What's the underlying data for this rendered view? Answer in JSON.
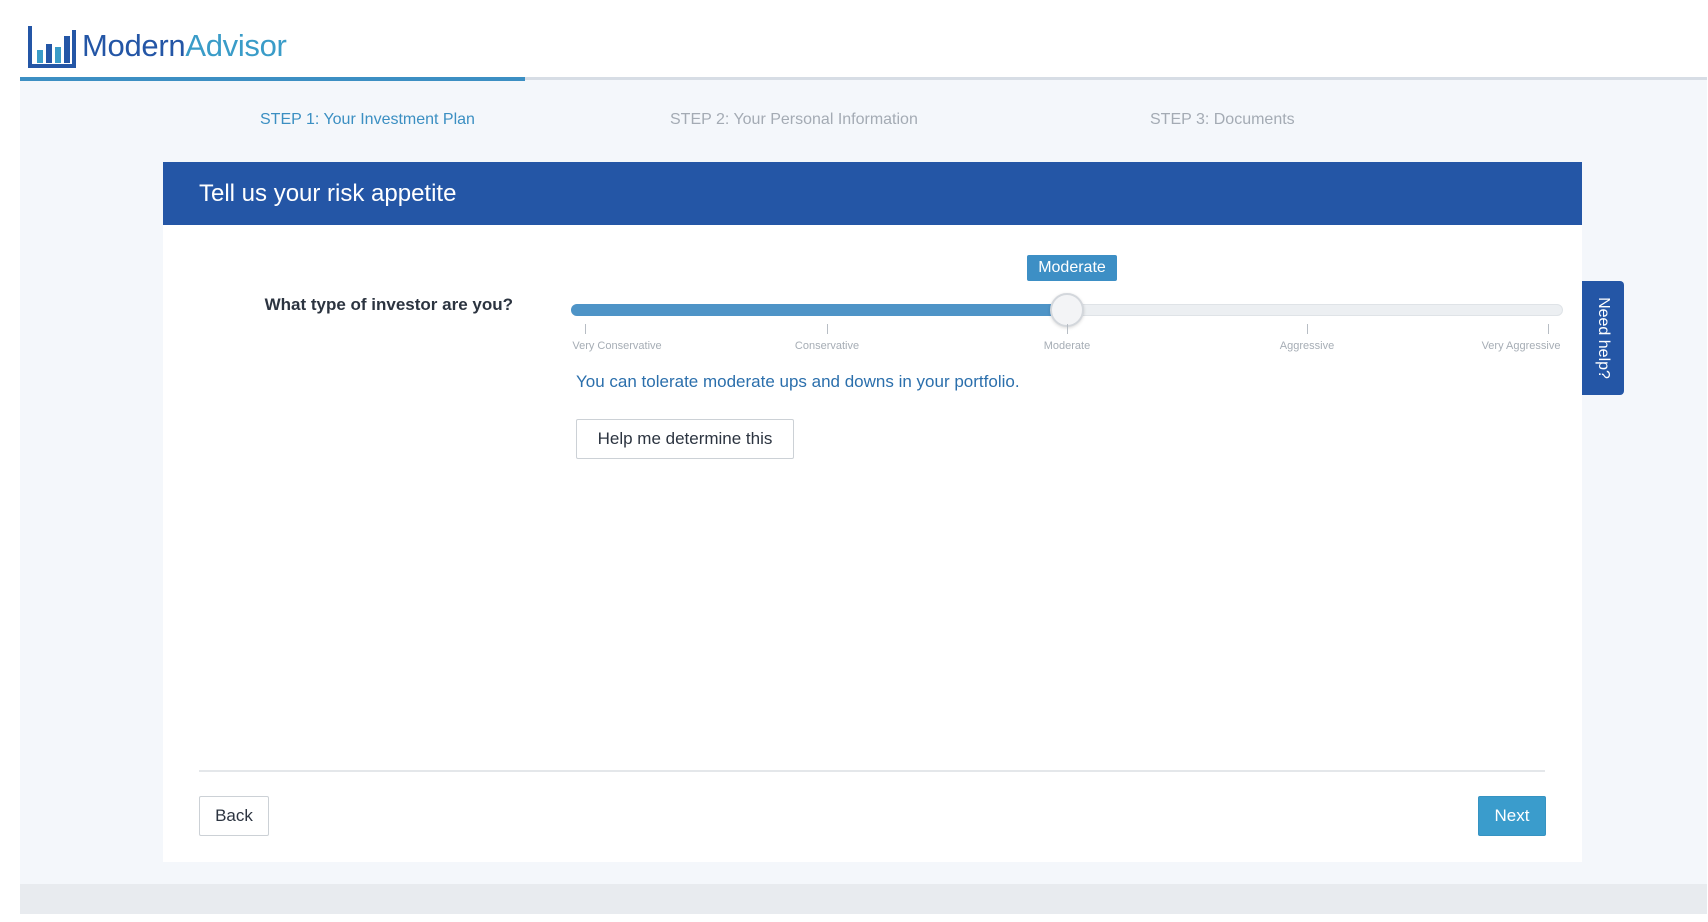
{
  "brand": {
    "part1": "Modern",
    "part2": "Advisor"
  },
  "colors": {
    "brand_blue": "#2456a6",
    "accent": "#3a9ccc",
    "link": "#2b6fac",
    "muted": "#a4abb4"
  },
  "steps": [
    {
      "label": "STEP 1: Your Investment Plan",
      "active": true
    },
    {
      "label": "STEP 2: Your Personal Information",
      "active": false
    },
    {
      "label": "STEP 3: Documents",
      "active": false
    }
  ],
  "card": {
    "title": "Tell us your risk appetite"
  },
  "question": {
    "label": "What type of investor are you?"
  },
  "slider": {
    "value_label": "Moderate",
    "selected_index": 2,
    "ticks": [
      "Very Conservative",
      "Conservative",
      "Moderate",
      "Aggressive",
      "Very Aggressive"
    ]
  },
  "description": "You can tolerate moderate ups and downs in your portfolio.",
  "help_button": "Help me determine this",
  "nav": {
    "back_label": "Back",
    "next_label": "Next"
  },
  "need_help": "Need help?",
  "icons": {
    "logo": "bar-chart-icon"
  }
}
